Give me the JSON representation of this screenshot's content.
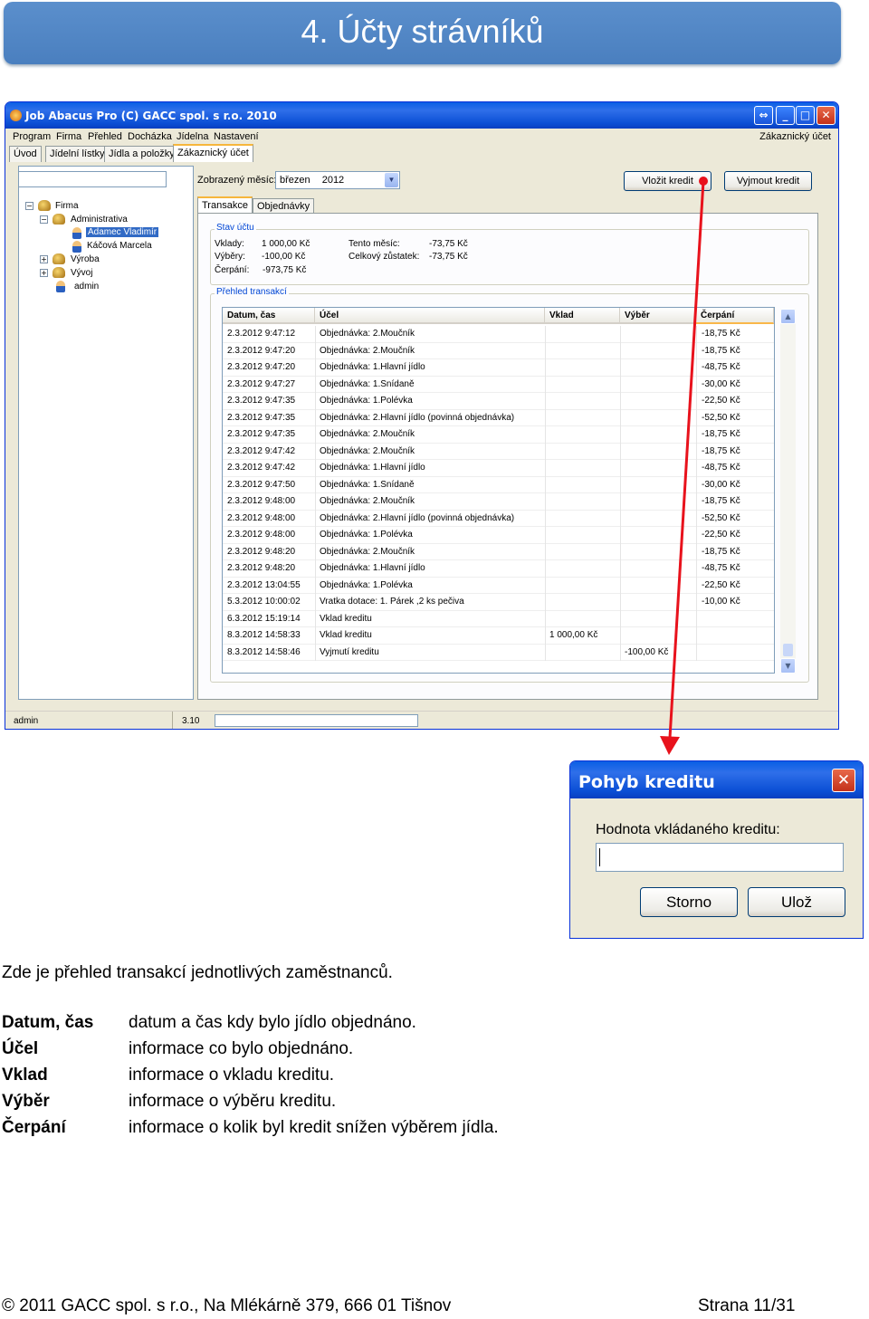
{
  "banner": {
    "title": "4. Účty strávníků"
  },
  "window": {
    "title": "Job Abacus Pro (C) GACC spol. s r.o. 2010",
    "menu": [
      "Program",
      "Firma",
      "Přehled",
      "Docházka",
      "Jídelna",
      "Nastavení"
    ],
    "menu_right": "Zákaznický účet",
    "tabs": [
      "Úvod",
      "Jídelní lístky",
      "Jídla a položky",
      "Zákaznický účet"
    ],
    "tree": {
      "root": "Firma",
      "groups": [
        "Administrativa",
        "Výroba",
        "Vývoj"
      ],
      "people": [
        "Adamec Vladimír",
        "Káčová Marcela"
      ],
      "other": "admin"
    },
    "month_label": "Zobrazený měsíc:",
    "month_value": "březen",
    "year_value": "2012",
    "btn_deposit": "Vložit kredit",
    "btn_withdraw": "Vyjmout kredit",
    "inner_tabs": [
      "Transakce",
      "Objednávky"
    ],
    "account_status": {
      "title": "Stav účtu",
      "deposits_label": "Vklady:",
      "deposits": "1 000,00 Kč",
      "withdrawals_label": "Výběry:",
      "withdrawals": "-100,00 Kč",
      "spending_label": "Čerpání:",
      "spending": "-973,75 Kč",
      "month_label": "Tento měsíc:",
      "month": "-73,75 Kč",
      "balance_label": "Celkový zůstatek:",
      "balance": "-73,75 Kč"
    },
    "tx_group_title": "Přehled transakcí",
    "columns": [
      "Datum, čas",
      "Účel",
      "Vklad",
      "Výběr",
      "Čerpání"
    ],
    "rows": [
      [
        "2.3.2012 9:47:12",
        "Objednávka: 2.Moučník",
        "",
        "",
        "-18,75 Kč"
      ],
      [
        "2.3.2012 9:47:20",
        "Objednávka: 2.Moučník",
        "",
        "",
        "-18,75 Kč"
      ],
      [
        "2.3.2012 9:47:20",
        "Objednávka: 1.Hlavní jídlo",
        "",
        "",
        "-48,75 Kč"
      ],
      [
        "2.3.2012 9:47:27",
        "Objednávka: 1.Snídaně",
        "",
        "",
        "-30,00 Kč"
      ],
      [
        "2.3.2012 9:47:35",
        "Objednávka: 1.Polévka",
        "",
        "",
        "-22,50 Kč"
      ],
      [
        "2.3.2012 9:47:35",
        "Objednávka: 2.Hlavní jídlo (povinná objednávka)",
        "",
        "",
        "-52,50 Kč"
      ],
      [
        "2.3.2012 9:47:35",
        "Objednávka: 2.Moučník",
        "",
        "",
        "-18,75 Kč"
      ],
      [
        "2.3.2012 9:47:42",
        "Objednávka: 2.Moučník",
        "",
        "",
        "-18,75 Kč"
      ],
      [
        "2.3.2012 9:47:42",
        "Objednávka: 1.Hlavní jídlo",
        "",
        "",
        "-48,75 Kč"
      ],
      [
        "2.3.2012 9:47:50",
        "Objednávka: 1.Snídaně",
        "",
        "",
        "-30,00 Kč"
      ],
      [
        "2.3.2012 9:48:00",
        "Objednávka: 2.Moučník",
        "",
        "",
        "-18,75 Kč"
      ],
      [
        "2.3.2012 9:48:00",
        "Objednávka: 2.Hlavní jídlo (povinná objednávka)",
        "",
        "",
        "-52,50 Kč"
      ],
      [
        "2.3.2012 9:48:00",
        "Objednávka: 1.Polévka",
        "",
        "",
        "-22,50 Kč"
      ],
      [
        "2.3.2012 9:48:20",
        "Objednávka: 2.Moučník",
        "",
        "",
        "-18,75 Kč"
      ],
      [
        "2.3.2012 9:48:20",
        "Objednávka: 1.Hlavní jídlo",
        "",
        "",
        "-48,75 Kč"
      ],
      [
        "2.3.2012 13:04:55",
        "Objednávka: 1.Polévka",
        "",
        "",
        "-22,50 Kč"
      ],
      [
        "5.3.2012 10:00:02",
        "Vratka dotace: 1. Párek ,2 ks pečiva",
        "",
        "",
        "-10,00 Kč"
      ],
      [
        "6.3.2012 15:19:14",
        "Vklad kreditu",
        "",
        "",
        ""
      ],
      [
        "8.3.2012 14:58:33",
        "Vklad kreditu",
        "1 000,00 Kč",
        "",
        ""
      ],
      [
        "8.3.2012 14:58:46",
        "Vyjmutí kreditu",
        "",
        "-100,00 Kč",
        ""
      ]
    ],
    "status": {
      "user": "admin",
      "version": "3.10"
    }
  },
  "dialog": {
    "title": "Pohyb kreditu",
    "label": "Hodnota vkládaného kreditu:",
    "input_value": "",
    "cancel": "Storno",
    "save": "Ulož"
  },
  "text": {
    "intro": "Zde je přehled transakcí jednotlivých zaměstnanců.",
    "definitions": [
      {
        "term": "Datum, čas",
        "desc": "datum a čas kdy bylo jídlo objednáno."
      },
      {
        "term": "Účel",
        "desc": "informace co bylo objednáno."
      },
      {
        "term": "Vklad",
        "desc": "informace o vkladu kreditu."
      },
      {
        "term": "Výběr",
        "desc": "informace o výběru kreditu."
      },
      {
        "term": "Čerpání",
        "desc": "informace o kolik byl kredit snížen výběrem jídla."
      }
    ],
    "footer_left": "© 2011 GACC spol. s r.o., Na Mlékárně 379, 666 01 Tišnov",
    "footer_right": "Strana 11/31"
  },
  "colors": {
    "banner": "#4f84c4",
    "arrow": "#e8121c",
    "xp_blue": "#0a5fe5"
  }
}
